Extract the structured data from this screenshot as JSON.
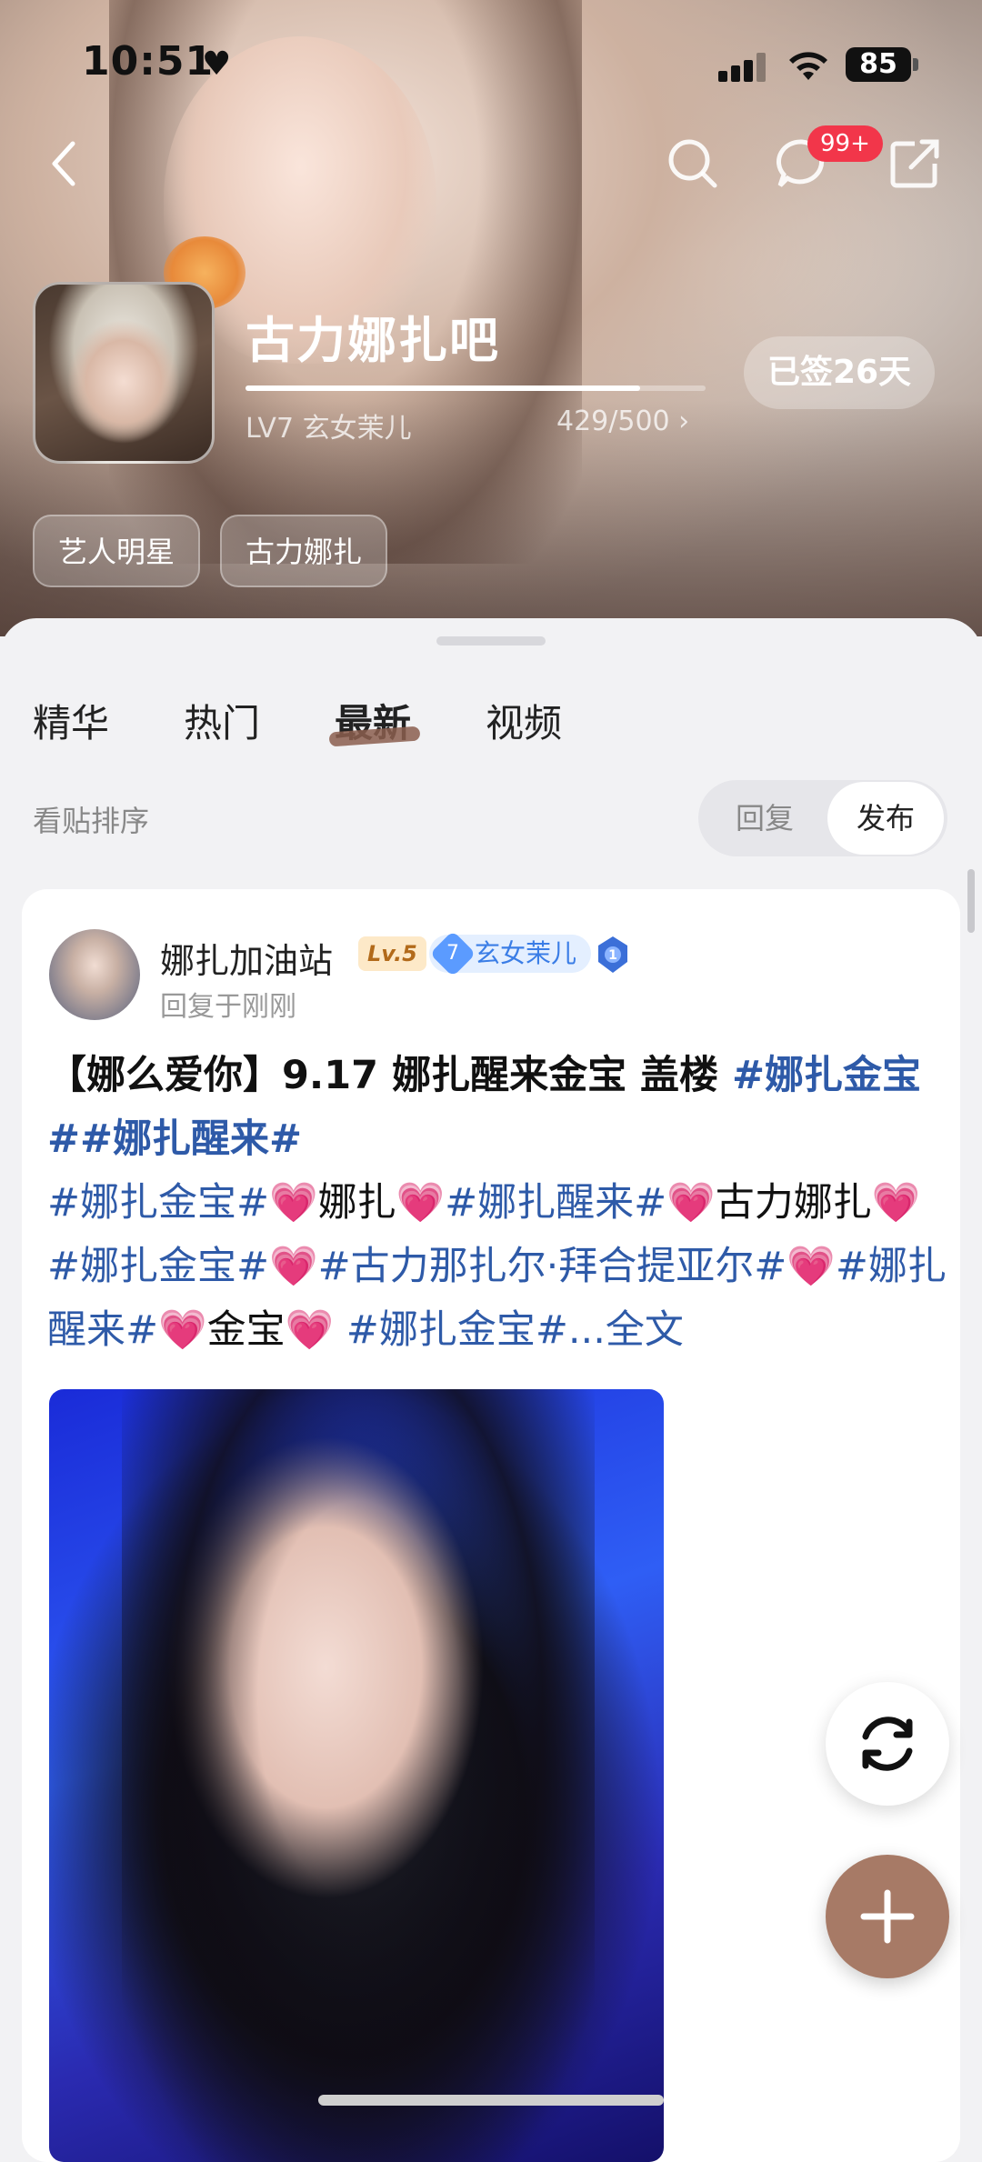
{
  "status_bar": {
    "time": "10:51",
    "battery": "85"
  },
  "nav": {
    "badge": "99+"
  },
  "forum": {
    "title": "古力娜扎吧",
    "level": "LV7 玄女茉儿",
    "progress_text": "429/500 ›",
    "progress": 0.858,
    "signin": "已签26天",
    "tags": [
      "艺人明星",
      "古力娜扎"
    ]
  },
  "tabs": [
    "精华",
    "热门",
    "最新",
    "视频"
  ],
  "active_tab": "最新",
  "sort": {
    "label": "看贴排序",
    "options": [
      "回复",
      "发布"
    ],
    "active": "发布"
  },
  "post": {
    "user_name": "娜扎加油站",
    "level_badge": "Lv.5",
    "fan_level": "7",
    "fan_title": "玄女茉儿",
    "reply_time": "回复于刚刚",
    "title": "【娜么爱你】9.17 娜扎醒来金宝 盖楼 ",
    "title_tags": "#娜扎金宝##娜扎醒来#",
    "body_segments": [
      {
        "t": "#娜扎金宝#",
        "k": "hash"
      },
      {
        "t": "💗",
        "k": "heart"
      },
      {
        "t": "娜扎",
        "k": "text"
      },
      {
        "t": "💗",
        "k": "heart"
      },
      {
        "t": "#娜扎醒来#",
        "k": "hash"
      },
      {
        "t": "💗",
        "k": "heart"
      },
      {
        "t": "古力娜扎",
        "k": "text"
      },
      {
        "t": "💗",
        "k": "heart"
      },
      {
        "t": " #娜扎金宝#",
        "k": "hash"
      },
      {
        "t": "💗",
        "k": "heart"
      },
      {
        "t": "#古力那扎尔·拜合提亚尔#",
        "k": "hash"
      },
      {
        "t": "💗",
        "k": "heart"
      },
      {
        "t": "#娜扎醒来#",
        "k": "hash"
      },
      {
        "t": "💗",
        "k": "heart"
      },
      {
        "t": "金宝",
        "k": "text"
      },
      {
        "t": "💗",
        "k": "heart"
      },
      {
        "t": " #娜扎金宝#",
        "k": "hash"
      },
      {
        "t": "...全文",
        "k": "more"
      }
    ]
  },
  "colors": {
    "hashtag": "#2e5aa8",
    "accent_brown": "#a77a66",
    "badge_red": "#f2364a"
  },
  "icons": [
    "back-arrow-icon",
    "search-icon",
    "message-icon",
    "share-icon",
    "refresh-icon",
    "plus-icon"
  ]
}
